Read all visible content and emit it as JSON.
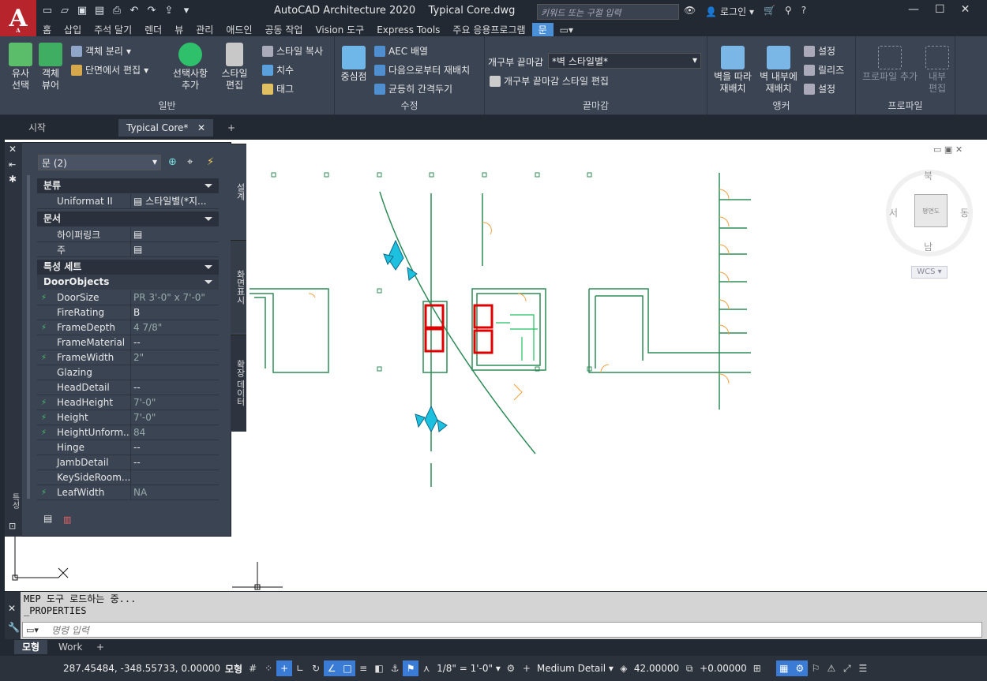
{
  "app": {
    "title": "AutoCAD Architecture 2020",
    "file": "Typical Core.dwg",
    "search_placeholder": "키워드 또는 구절 입력",
    "login": "로그인",
    "logo_letter": "A",
    "logo_sub": "A"
  },
  "tabs": [
    "홈",
    "삽입",
    "주석 달기",
    "렌더",
    "뷰",
    "관리",
    "애드인",
    "공동 작업",
    "Vision 도구",
    "Express Tools",
    "주요 응용프로그램",
    "문"
  ],
  "ribbon": {
    "general": {
      "title": "일반",
      "similar": "유사\n선택",
      "viewer": "객체\n뷰어",
      "isolate": "객체 분리",
      "section_edit": "단면에서 편집",
      "add_selected": "선택사항\n추가",
      "style_edit": "스타일\n편집",
      "copy_style": "스타일 복사",
      "dims": "치수",
      "tag": "태그"
    },
    "modify": {
      "title": "수정",
      "center": "중심점",
      "aec_array": "AEC 배열",
      "reposition_from": "다음으로부터 재배치",
      "space_evenly": "균등히 간격두기"
    },
    "endcap": {
      "title": "끝마감",
      "label": "개구부 끝마감",
      "value": "*벽 스타일별*",
      "edit": "개구부 끝마감 스타일 편집"
    },
    "anchor": {
      "title": "앵커",
      "along_wall": "벽을 따라\n재배치",
      "within_wall": "벽 내부에\n재배치",
      "set1": "설정",
      "release": "릴리즈",
      "set2": "설정"
    },
    "profile": {
      "title": "프로파일",
      "add": "프로파일 추가",
      "edit": "내부\n편집"
    }
  },
  "doctabs": {
    "start": "시작",
    "current": "Typical Core*",
    "add": "+"
  },
  "props": {
    "selector": "문 (2)",
    "categories": {
      "classification": "분류",
      "document": "문서",
      "propsets": "특성 세트",
      "doorobjects": "DoorObjects"
    },
    "uniformat": {
      "name": "Uniformat II",
      "value": "스타일별(*지..."
    },
    "hyperlink": "하이퍼링크",
    "note": "주",
    "rows": [
      {
        "name": "DoorSize",
        "value": "PR 3'-0\" x 7'-0\""
      },
      {
        "name": "FireRating",
        "value": "B"
      },
      {
        "name": "FrameDepth",
        "value": "4 7/8\""
      },
      {
        "name": "FrameMaterial",
        "value": "--"
      },
      {
        "name": "FrameWidth",
        "value": "2\""
      },
      {
        "name": "Glazing",
        "value": ""
      },
      {
        "name": "HeadDetail",
        "value": "--"
      },
      {
        "name": "HeadHeight",
        "value": "7'-0\""
      },
      {
        "name": "Height",
        "value": "7'-0\""
      },
      {
        "name": "HeightUnform...",
        "value": "84"
      },
      {
        "name": "Hinge",
        "value": "--"
      },
      {
        "name": "JambDetail",
        "value": "--"
      },
      {
        "name": "KeySideRoom...",
        "value": ""
      },
      {
        "name": "LeafWidth",
        "value": "NA"
      }
    ],
    "sidetabs": [
      "설계",
      "화면표시",
      "확장 데이터"
    ],
    "left_label": "특성"
  },
  "viewcube": {
    "n": "북",
    "s": "남",
    "e": "동",
    "w": "서",
    "face": "평면도",
    "wcs": "WCS"
  },
  "command": {
    "line1": "MEP 도구 로드하는 중...",
    "line2": "_PROPERTIES",
    "placeholder": "명령 입력"
  },
  "layouts": {
    "model": "모형",
    "work": "Work",
    "add": "+"
  },
  "status": {
    "coords": "287.45484, -348.55733, 0.00000",
    "model": "모형",
    "scale": "1/8\" = 1'-0\"",
    "detail": "Medium Detail",
    "elev": "42.00000",
    "cut": "+0.00000"
  }
}
